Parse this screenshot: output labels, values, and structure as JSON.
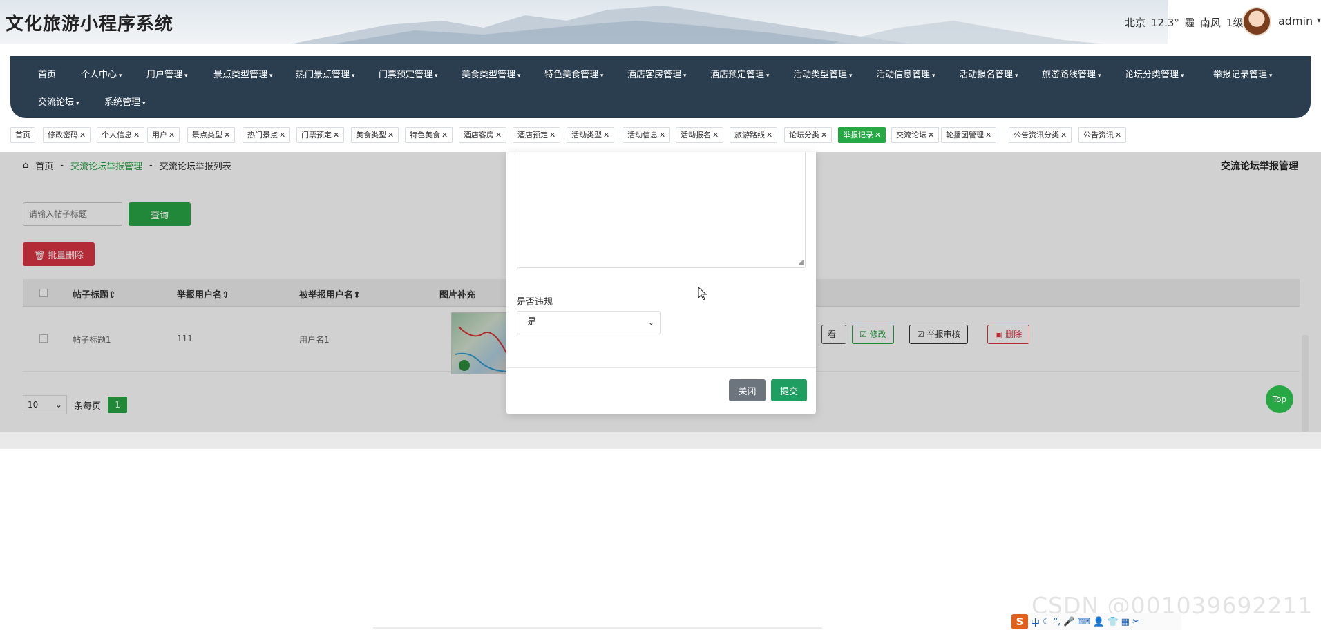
{
  "header": {
    "title": "文化旅游小程序系统",
    "weather": {
      "city": "北京",
      "temp": "12.3°",
      "icon": "haze-icon",
      "icon_glyph": "霾",
      "wind": "南风",
      "level": "1级"
    },
    "user": "admin",
    "user_caret": "▾"
  },
  "nav": {
    "items": [
      {
        "label": "首页",
        "has_menu": false
      },
      {
        "label": "个人中心",
        "has_menu": true
      },
      {
        "label": "用户管理",
        "has_menu": true
      },
      {
        "label": "景点类型管理",
        "has_menu": true
      },
      {
        "label": "热门景点管理",
        "has_menu": true
      },
      {
        "label": "门票预定管理",
        "has_menu": true
      },
      {
        "label": "美食类型管理",
        "has_menu": true
      },
      {
        "label": "特色美食管理",
        "has_menu": true
      },
      {
        "label": "酒店客房管理",
        "has_menu": true
      },
      {
        "label": "酒店预定管理",
        "has_menu": true
      },
      {
        "label": "活动类型管理",
        "has_menu": true
      },
      {
        "label": "活动信息管理",
        "has_menu": true
      },
      {
        "label": "活动报名管理",
        "has_menu": true
      },
      {
        "label": "旅游路线管理",
        "has_menu": true
      },
      {
        "label": "论坛分类管理",
        "has_menu": true
      },
      {
        "label": "举报记录管理",
        "has_menu": true
      },
      {
        "label": "交流论坛",
        "has_menu": true
      },
      {
        "label": "系统管理",
        "has_menu": true
      }
    ],
    "caret": "▾"
  },
  "tags": [
    {
      "label": "首页",
      "closable": false,
      "active": false
    },
    {
      "label": "修改密码",
      "closable": true,
      "active": false
    },
    {
      "label": "个人信息",
      "closable": true,
      "active": false
    },
    {
      "label": "用户",
      "closable": true,
      "active": false
    },
    {
      "label": "景点类型",
      "closable": true,
      "active": false
    },
    {
      "label": "热门景点",
      "closable": true,
      "active": false
    },
    {
      "label": "门票预定",
      "closable": true,
      "active": false
    },
    {
      "label": "美食类型",
      "closable": true,
      "active": false
    },
    {
      "label": "特色美食",
      "closable": true,
      "active": false
    },
    {
      "label": "酒店客房",
      "closable": true,
      "active": false
    },
    {
      "label": "酒店预定",
      "closable": true,
      "active": false
    },
    {
      "label": "活动类型",
      "closable": true,
      "active": false
    },
    {
      "label": "活动信息",
      "closable": true,
      "active": false
    },
    {
      "label": "活动报名",
      "closable": true,
      "active": false
    },
    {
      "label": "旅游路线",
      "closable": true,
      "active": false
    },
    {
      "label": "论坛分类",
      "closable": true,
      "active": false
    },
    {
      "label": "举报记录",
      "closable": true,
      "active": true
    },
    {
      "label": "交流论坛",
      "closable": true,
      "active": false
    },
    {
      "label": "轮播图管理",
      "closable": true,
      "active": false
    },
    {
      "label": "公告资讯分类",
      "closable": true,
      "active": false
    },
    {
      "label": "公告资讯",
      "closable": true,
      "active": false
    }
  ],
  "tag_close_glyph": "✕",
  "breadcrumb": {
    "home_icon": "home-icon",
    "home": "首页",
    "sep": "-",
    "section": "交流论坛举报管理",
    "current": "交流论坛举报列表"
  },
  "page_heading": "交流论坛举报管理",
  "search": {
    "placeholder": "请输入帖子标题",
    "button": "查询"
  },
  "batch_delete": {
    "icon": "trash-icon",
    "label": "批量删除"
  },
  "table": {
    "columns": [
      "帖子标题",
      "举报用户名",
      "被举报用户名",
      "图片补充"
    ],
    "sort_glyph": "⇕",
    "rows": [
      {
        "title": "帖子标题1",
        "reporter": "111",
        "reported": "用户名1",
        "image": "map-thumbnail"
      }
    ],
    "actions": {
      "view": "看",
      "edit": "修改",
      "review": "举报审核",
      "delete": "删除"
    }
  },
  "pager": {
    "page_size": "10",
    "per_page_label": "条每页",
    "current_page": "1"
  },
  "top_button": "Top",
  "modal": {
    "field_label": "是否违规",
    "field_value": "是",
    "close": "关闭",
    "submit": "提交"
  },
  "watermark": "CSDN @001039692211",
  "ime": {
    "logo": "S",
    "mode": "中"
  },
  "colors": {
    "primary": "#28a745",
    "danger": "#dc3545",
    "nav_bg": "#2b3e50",
    "submit": "#1e9e61",
    "close": "#6c757d"
  }
}
